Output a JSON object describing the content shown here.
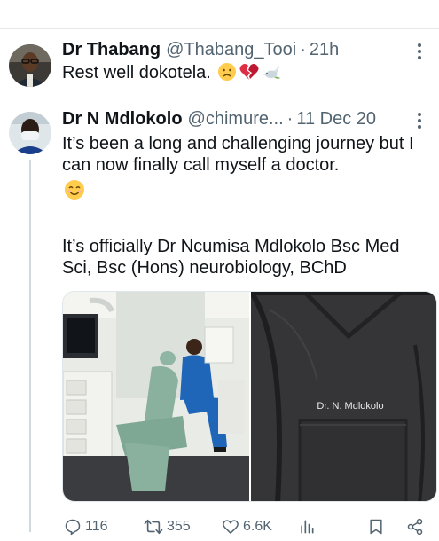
{
  "tweets": [
    {
      "name": "Dr Thabang",
      "handle": "@Thabang_Tooi",
      "separator": "·",
      "time": "21h",
      "text": "Rest well dokotela.",
      "emojis": [
        "crying-face",
        "broken-heart",
        "dove"
      ]
    },
    {
      "name": "Dr N Mdlokolo",
      "handle": "@chimure...",
      "separator": "·",
      "time": "11 Dec 20",
      "text_p1": "It’s been a long and challenging journey but I can now finally call myself a doctor.",
      "text_p1_emoji": "smiling-face",
      "text_p2": "It’s officially Dr Ncumisa Mdlokolo Bsc Med Sci, Bsc (Hons) neurobiology, BChD",
      "media": {
        "photo1": "person in blue scrubs sitting in a dental chair",
        "photo2": {
          "coat_label": "Dr. N. Mdlokolo"
        }
      },
      "actions": {
        "replies": "116",
        "retweets": "355",
        "likes": "6.6K"
      }
    }
  ],
  "colors": {
    "text": "#0f1419",
    "secondary": "#536471",
    "divider": "#e6e9ec",
    "thread_line": "#cfd9de"
  }
}
